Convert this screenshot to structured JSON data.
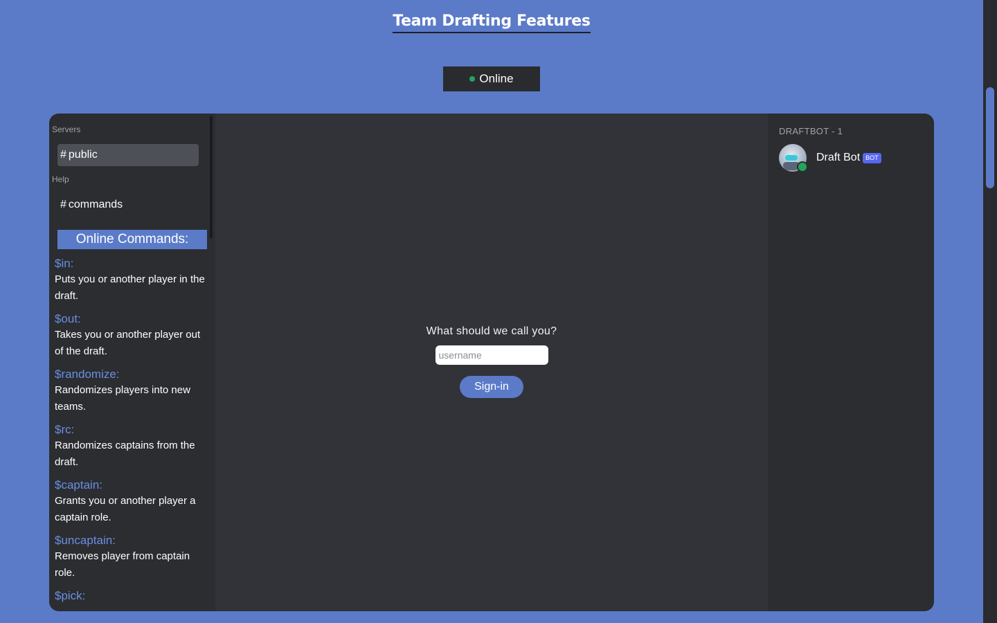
{
  "page": {
    "title": "Team Drafting Features",
    "status": "Online"
  },
  "sidebar": {
    "sections": [
      {
        "label": "Servers",
        "channels": [
          {
            "hash": "#",
            "name": "public",
            "active": true
          }
        ]
      },
      {
        "label": "Help",
        "channels": [
          {
            "hash": "#",
            "name": "commands",
            "active": false
          }
        ]
      }
    ],
    "commands_header": "Online Commands:",
    "commands": [
      {
        "name": "$in:",
        "description": "Puts you or another player in the draft."
      },
      {
        "name": "$out:",
        "description": "Takes you or another player out of the draft."
      },
      {
        "name": "$randomize:",
        "description": "Randomizes players into new teams."
      },
      {
        "name": "$rc:",
        "description": "Randomizes captains from the draft."
      },
      {
        "name": "$captain:",
        "description": "Grants you or another player a captain role."
      },
      {
        "name": "$uncaptain:",
        "description": "Removes player from captain role."
      },
      {
        "name": "$pick:",
        "description": ""
      }
    ]
  },
  "login": {
    "prompt": "What should we call you?",
    "username_placeholder": "username",
    "username_value": "",
    "signin_label": "Sign-in"
  },
  "members": {
    "header": "DRAFTBOT - 1",
    "list": [
      {
        "name": "Draft Bot",
        "badge": "BOT",
        "status": "online",
        "avatar": "robot-avatar"
      }
    ]
  },
  "colors": {
    "background": "#5b7bc9",
    "panel": "#313338",
    "sidebar": "#2b2d31",
    "online": "#23a55a",
    "command_name": "#6b8fe0",
    "bot_badge": "#5865f2"
  }
}
